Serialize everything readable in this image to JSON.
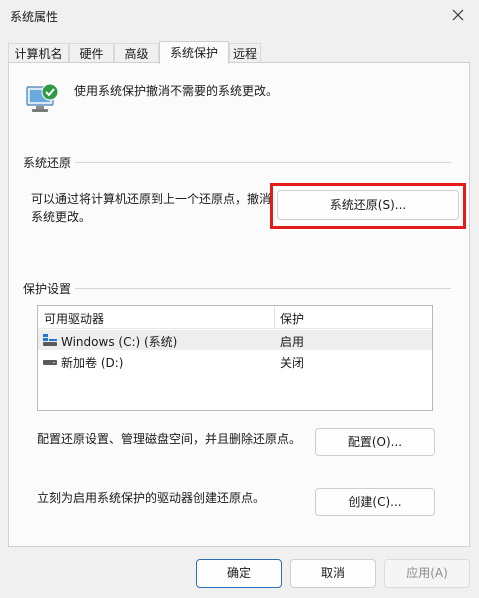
{
  "window": {
    "title": "系统属性"
  },
  "tabs": [
    {
      "label": "计算机名"
    },
    {
      "label": "硬件"
    },
    {
      "label": "高级"
    },
    {
      "label": "系统保护"
    },
    {
      "label": "远程"
    }
  ],
  "intro": {
    "text": "使用系统保护撤消不需要的系统更改。"
  },
  "system_restore": {
    "group_label": "系统还原",
    "line1": "可以通过将计算机还原到上一个还原点，撤消",
    "line2": "系统更改。",
    "button_label": "系统还原(S)..."
  },
  "protection_settings": {
    "group_label": "保护设置",
    "columns": {
      "drive": "可用驱动器",
      "protection": "保护"
    },
    "drives": [
      {
        "name": "Windows (C:) (系统)",
        "protection": "启用"
      },
      {
        "name": "新加卷 (D:)",
        "protection": "关闭"
      }
    ],
    "configure_text": "配置还原设置、管理磁盘空间，并且删除还原点。",
    "configure_button": "配置(O)...",
    "create_text": "立刻为启用系统保护的驱动器创建还原点。",
    "create_button": "创建(C)..."
  },
  "footer": {
    "ok": "确定",
    "cancel": "取消",
    "apply": "应用(A)"
  },
  "colors": {
    "highlight": "#e31b1b",
    "accent": "#2d6fb5"
  }
}
